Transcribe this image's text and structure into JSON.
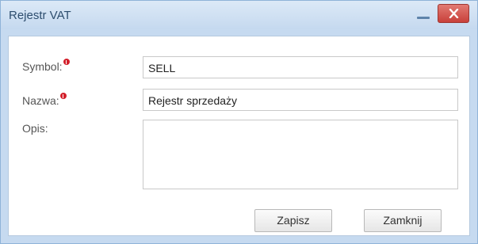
{
  "window": {
    "title": "Rejestr VAT"
  },
  "form": {
    "symbol": {
      "label": "Symbol:",
      "value": "SELL",
      "required": true
    },
    "nazwa": {
      "label": "Nazwa:",
      "value": "Rejestr sprzedaży",
      "required": true
    },
    "opis": {
      "label": "Opis:",
      "value": ""
    }
  },
  "buttons": {
    "save_label": "Zapisz",
    "close_label": "Zamknij"
  },
  "icons": {
    "minimize": "minimize-icon",
    "close": "close-icon",
    "required": "required-indicator-icon"
  },
  "colors": {
    "frame": "#c6daf0",
    "close_button": "#c8403a",
    "required_indicator": "#d3202b"
  }
}
